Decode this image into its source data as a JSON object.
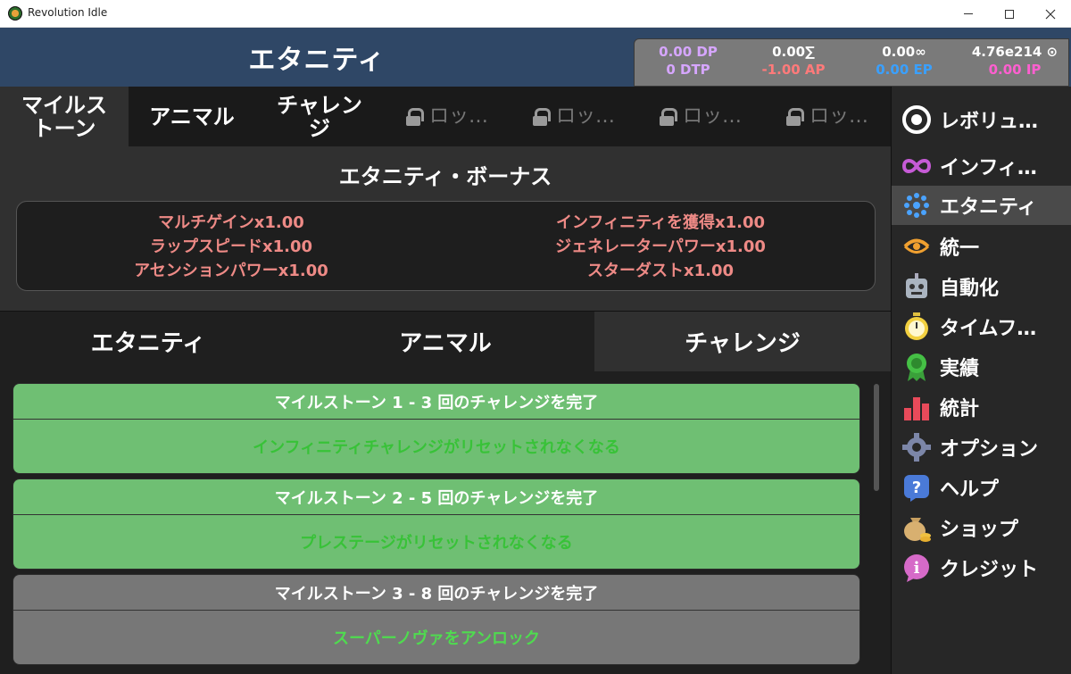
{
  "window": {
    "title": "Revolution Idle"
  },
  "header": {
    "title": "エタニティ"
  },
  "resources": {
    "dp": "0.00 DP",
    "dtp": "0 DTP",
    "sigma": "0.00∑",
    "ap": "-1.00 AP",
    "inf": "0.00∞",
    "ep": "0.00 EP",
    "top_value": "4.76e214 ⊙",
    "ip": "0.00 IP",
    "colors": {
      "dp": "#d6a6ff",
      "ap": "#ff7a7a",
      "ep": "#3aa0ff",
      "ip": "#ff5fd0",
      "white": "#ffffff"
    }
  },
  "top_tabs": [
    {
      "label": "マイルス\nトーン",
      "active": true
    },
    {
      "label": "アニマル"
    },
    {
      "label": "チャレン\nジ"
    },
    {
      "label": "ロッ…",
      "locked": true
    },
    {
      "label": "ロッ…",
      "locked": true
    },
    {
      "label": "ロッ…",
      "locked": true
    },
    {
      "label": "ロッ…",
      "locked": true
    }
  ],
  "bonus": {
    "title": "エタニティ・ボーナス",
    "left": [
      "マルチゲインx1.00",
      "ラップスピードx1.00",
      "アセンションパワーx1.00"
    ],
    "right": [
      "インフィニティを獲得x1.00",
      "ジェネレーターパワーx1.00",
      "スターダストx1.00"
    ]
  },
  "sub_tabs": [
    {
      "label": "エタニティ"
    },
    {
      "label": "アニマル"
    },
    {
      "label": "チャレンジ",
      "active": true
    }
  ],
  "milestones": [
    {
      "head": "マイルストーン 1 - 3 回のチャレンジを完了",
      "reward": "インフィニティチャレンジがリセットされなくなる",
      "done": true
    },
    {
      "head": "マイルストーン 2 - 5 回のチャレンジを完了",
      "reward": "プレステージがリセットされなくなる",
      "done": true
    },
    {
      "head": "マイルストーン 3 - 8 回のチャレンジを完了",
      "reward": "スーパーノヴァをアンロック",
      "done": false
    }
  ],
  "sidebar": [
    {
      "label": "レボリュ…",
      "icon": "revolution-icon"
    },
    {
      "label": "インフィ…",
      "icon": "infinity-icon"
    },
    {
      "label": "エタニティ",
      "icon": "eternity-icon",
      "active": true
    },
    {
      "label": "統一",
      "icon": "unify-icon"
    },
    {
      "label": "自動化",
      "icon": "robot-icon"
    },
    {
      "label": "タイムフ…",
      "icon": "stopwatch-icon"
    },
    {
      "label": "実績",
      "icon": "achievement-ribbon-icon"
    },
    {
      "label": "統計",
      "icon": "bar-chart-icon"
    },
    {
      "label": "オプション",
      "icon": "gear-icon"
    },
    {
      "label": "ヘルプ",
      "icon": "question-icon"
    },
    {
      "label": "ショップ",
      "icon": "money-bag-icon"
    },
    {
      "label": "クレジット",
      "icon": "info-icon"
    }
  ]
}
